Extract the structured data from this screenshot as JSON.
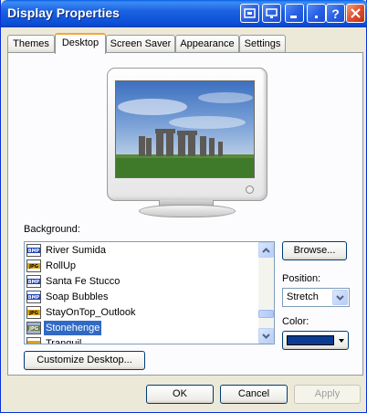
{
  "window": {
    "title": "Display Properties",
    "buttons": [
      "help",
      "minimize",
      "maximize",
      "close"
    ]
  },
  "tabs": [
    {
      "label": "Themes",
      "active": false
    },
    {
      "label": "Desktop",
      "active": true
    },
    {
      "label": "Screen Saver",
      "active": false
    },
    {
      "label": "Appearance",
      "active": false
    },
    {
      "label": "Settings",
      "active": false
    }
  ],
  "desktop": {
    "background_label": "Background:",
    "background_items": [
      {
        "label": "River Sumida",
        "icon": "bmp-file-icon"
      },
      {
        "label": "RollUp",
        "icon": "jpg-file-icon"
      },
      {
        "label": "Santa Fe Stucco",
        "icon": "bmp-file-icon"
      },
      {
        "label": "Soap Bubbles",
        "icon": "bmp-file-icon"
      },
      {
        "label": "StayOnTop_Outlook",
        "icon": "jpg-file-icon"
      },
      {
        "label": "Stonehenge",
        "icon": "jpg-file-icon",
        "selected": true
      },
      {
        "label": "Tranquil",
        "icon": "jpg-file-icon"
      }
    ],
    "browse_label": "Browse...",
    "position_label": "Position:",
    "position_value": "Stretch",
    "color_label": "Color:",
    "color_value": "#0a3d91",
    "customize_label": "Customize Desktop..."
  },
  "footer": {
    "ok_label": "OK",
    "cancel_label": "Cancel",
    "apply_label": "Apply"
  },
  "colors": {
    "titlebar": "#0a5fe6",
    "selection": "#316ac5",
    "tab_highlight": "#f1a738"
  }
}
